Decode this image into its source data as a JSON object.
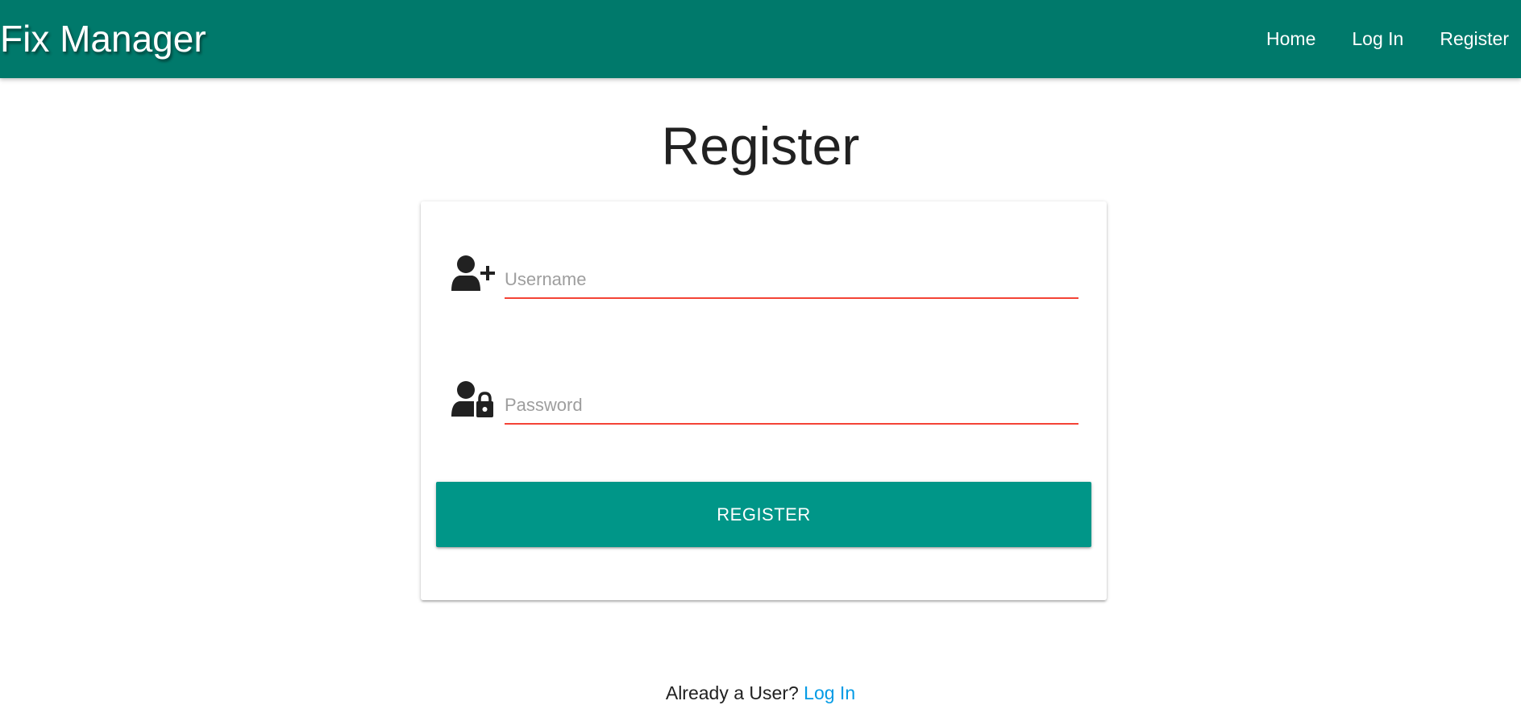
{
  "navbar": {
    "brand": "Fix Manager",
    "links": [
      {
        "label": "Home"
      },
      {
        "label": "Log In"
      },
      {
        "label": "Register"
      }
    ],
    "background_color": "#00796b"
  },
  "page": {
    "title": "Register"
  },
  "form": {
    "username": {
      "icon": "user-plus-icon",
      "placeholder": "Username",
      "value": ""
    },
    "password": {
      "icon": "user-lock-icon",
      "placeholder": "Password",
      "value": ""
    },
    "submit_label": "REGISTER",
    "invalid_underline_color": "#f44336",
    "button_color": "#009688"
  },
  "footer": {
    "prompt": "Already a User?",
    "link_label": "Log In",
    "link_color": "#039be5"
  }
}
